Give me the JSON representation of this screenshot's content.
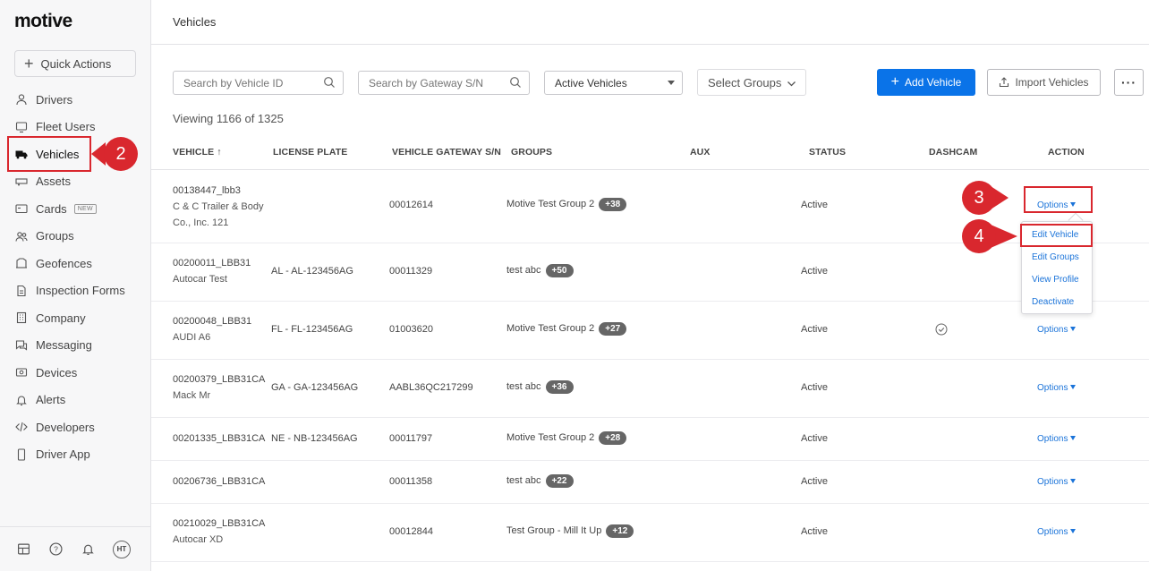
{
  "app": {
    "logo": "motive",
    "page_title": "Vehicles"
  },
  "sidebar": {
    "quick_actions": "Quick Actions",
    "items": [
      {
        "label": "Drivers",
        "icon": "user-icon"
      },
      {
        "label": "Fleet Users",
        "icon": "monitor-icon"
      },
      {
        "label": "Vehicles",
        "icon": "truck-icon",
        "active": true
      },
      {
        "label": "Assets",
        "icon": "trailer-icon"
      },
      {
        "label": "Cards",
        "icon": "card-icon",
        "badge": "NEW"
      },
      {
        "label": "Groups",
        "icon": "group-icon"
      },
      {
        "label": "Geofences",
        "icon": "geofence-icon"
      },
      {
        "label": "Inspection Forms",
        "icon": "form-icon"
      },
      {
        "label": "Company",
        "icon": "building-icon"
      },
      {
        "label": "Messaging",
        "icon": "chat-icon"
      },
      {
        "label": "Devices",
        "icon": "device-icon"
      },
      {
        "label": "Alerts",
        "icon": "bell-icon"
      },
      {
        "label": "Developers",
        "icon": "code-icon"
      },
      {
        "label": "Driver App",
        "icon": "phone-icon"
      }
    ],
    "footer": {
      "avatar": "HT"
    }
  },
  "toolbar": {
    "search_vehicle_placeholder": "Search by Vehicle ID",
    "search_gateway_placeholder": "Search by Gateway S/N",
    "status_filter": "Active Vehicles",
    "groups_filter": "Select Groups",
    "add_vehicle": "Add Vehicle",
    "import_vehicles": "Import Vehicles",
    "more": "···"
  },
  "viewing": "Viewing 1166 of 1325",
  "table": {
    "headers": {
      "vehicle": "VEHICLE ↑",
      "license_plate": "LICENSE PLATE",
      "gateway": "VEHICLE GATEWAY S/N",
      "groups": "GROUPS",
      "aux": "AUX",
      "status": "STATUS",
      "dashcam": "DASHCAM",
      "action": "ACTION"
    },
    "rows": [
      {
        "id": "00138447_lbb3",
        "sub1": "C & C Trailer & Body",
        "sub2": "Co., Inc. 121",
        "plate": "",
        "gateway": "00012614",
        "group": "Motive Test Group 2",
        "count": "+38",
        "status": "Active",
        "action": "Options"
      },
      {
        "id": "00200011_LBB31",
        "sub1": "Autocar Test",
        "plate": "AL - AL-123456AG",
        "gateway": "00011329",
        "group": "test abc",
        "count": "+50",
        "status": "Active"
      },
      {
        "id": "00200048_LBB31",
        "sub1": "AUDI A6",
        "plate": "FL - FL-123456AG",
        "gateway": "01003620",
        "group": "Motive Test Group 2",
        "count": "+27",
        "status": "Active",
        "action": "Options"
      },
      {
        "id": "00200379_LBB31CA",
        "sub1": "Mack Mr",
        "plate": "GA - GA-123456AG",
        "gateway": "AABL36QC217299",
        "group": "test abc",
        "count": "+36",
        "status": "Active",
        "action": "Options"
      },
      {
        "id": "00201335_LBB31CA",
        "plate": "NE - NB-123456AG",
        "gateway": "00011797",
        "group": "Motive Test Group 2",
        "count": "+28",
        "status": "Active",
        "action": "Options"
      },
      {
        "id": "00206736_LBB31CA",
        "plate": "",
        "gateway": "00011358",
        "group": "test abc",
        "count": "+22",
        "status": "Active",
        "action": "Options"
      },
      {
        "id": "00210029_LBB31CA",
        "sub1": "Autocar XD",
        "plate": "",
        "gateway": "00012844",
        "group": "Test Group - Mill It Up",
        "count": "+12",
        "status": "Active",
        "action": "Options"
      }
    ]
  },
  "menu": {
    "items": [
      "Edit Vehicle",
      "Edit Groups",
      "View Profile",
      "Deactivate"
    ]
  },
  "callouts": {
    "c2": "2",
    "c3": "3",
    "c4": "4"
  },
  "colors": {
    "accent": "#0a73e8",
    "callout": "#d9272e",
    "link": "#1a73d9"
  }
}
